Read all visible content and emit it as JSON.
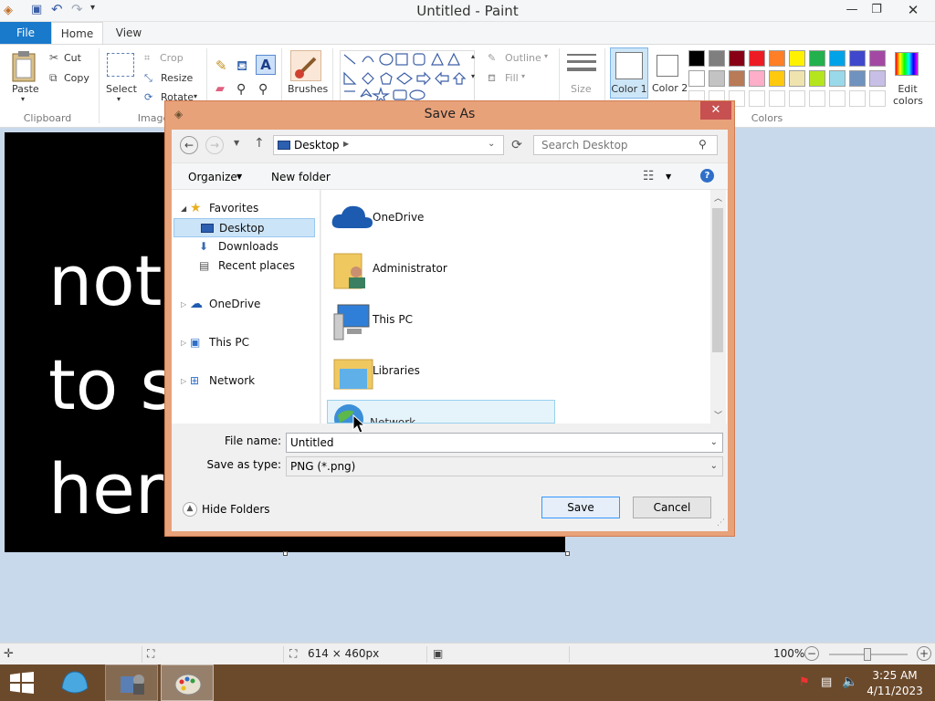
{
  "window": {
    "title": "Untitled - Paint"
  },
  "tabs": {
    "file": "File",
    "home": "Home",
    "view": "View"
  },
  "ribbon": {
    "clipboard": {
      "paste": "Paste",
      "cut": "Cut",
      "copy": "Copy",
      "label": "Clipboard"
    },
    "image": {
      "select": "Select",
      "crop": "Crop",
      "resize": "Resize",
      "rotate": "Rotate",
      "label": "Image"
    },
    "brushes": "Brushes",
    "shapes": {
      "outline": "Outline",
      "fill": "Fill"
    },
    "size": "Size",
    "color1": "Color 1",
    "color2": "Color 2",
    "colors_label": "Colors",
    "edit_colors": "Edit colors",
    "palette_row1": [
      "#000000",
      "#7f7f7f",
      "#880015",
      "#ed1c24",
      "#ff7f27",
      "#fff200",
      "#22b14c",
      "#00a2e8",
      "#3f48cc",
      "#a349a4"
    ],
    "palette_row2": [
      "#ffffff",
      "#c3c3c3",
      "#b97a57",
      "#ffaec9",
      "#ffc90e",
      "#efe4b0",
      "#b5e61d",
      "#99d9ea",
      "#7092be",
      "#c8bfe7"
    ]
  },
  "canvas": {
    "lines": [
      "not",
      "to s",
      "her"
    ]
  },
  "dialog": {
    "title": "Save As",
    "address": "Desktop",
    "search_placeholder": "Search Desktop",
    "organize": "Organize",
    "new_folder": "New folder",
    "nav": {
      "favorites": "Favorites",
      "desktop": "Desktop",
      "downloads": "Downloads",
      "recent": "Recent places",
      "onedrive": "OneDrive",
      "thispc": "This PC",
      "network": "Network"
    },
    "items": [
      "OneDrive",
      "Administrator",
      "This PC",
      "Libraries",
      "Network"
    ],
    "file_name_label": "File name:",
    "file_name_value": "Untitled",
    "save_type_label": "Save as type:",
    "save_type_value": "PNG (*.png)",
    "hide_folders": "Hide Folders",
    "save": "Save",
    "cancel": "Cancel"
  },
  "status": {
    "dimensions": "614 × 460px",
    "zoom": "100%"
  },
  "taskbar": {
    "time": "3:25 AM",
    "date": "4/11/2023"
  }
}
